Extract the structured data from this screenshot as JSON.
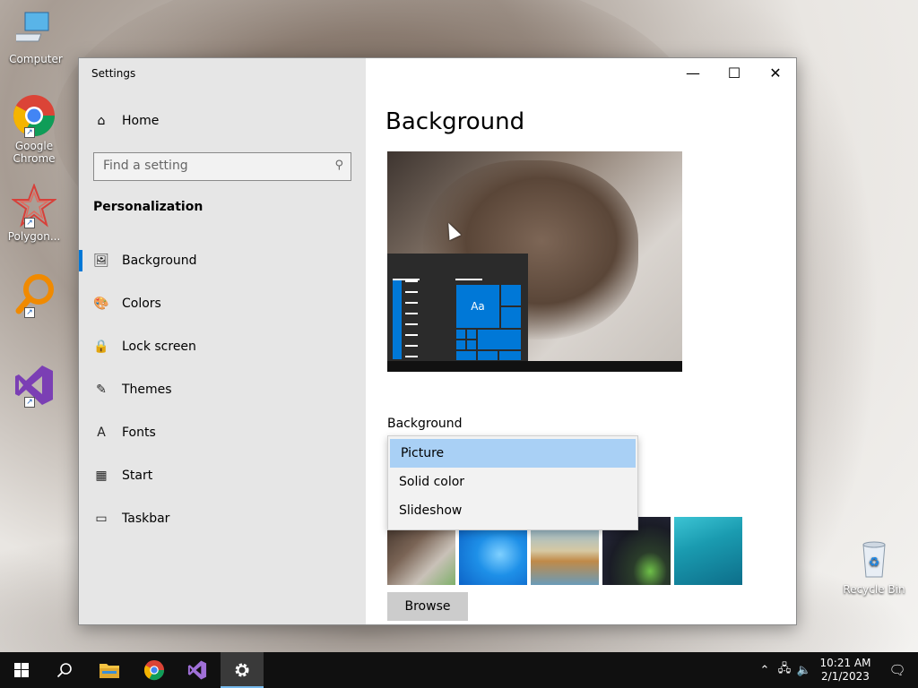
{
  "desktop": {
    "icons": [
      {
        "label": "Computer",
        "icon": "computer-icon"
      },
      {
        "label": "Google Chrome",
        "icon": "chrome-icon"
      },
      {
        "label": "Polygon...",
        "icon": "polygon-icon"
      },
      {
        "label": "",
        "icon": "magnifier-app-icon"
      },
      {
        "label": "",
        "icon": "visual-studio-icon"
      }
    ],
    "recycle_bin": "Recycle Bin"
  },
  "window": {
    "title": "Settings",
    "controls": {
      "minimize": "—",
      "maximize": "☐",
      "close": "✕"
    }
  },
  "sidebar": {
    "home_label": "Home",
    "search_placeholder": "Find a setting",
    "section_title": "Personalization",
    "items": [
      {
        "label": "Background",
        "icon": "picture-icon",
        "glyph": "🖼",
        "active": true
      },
      {
        "label": "Colors",
        "icon": "palette-icon",
        "glyph": "🎨",
        "active": false
      },
      {
        "label": "Lock screen",
        "icon": "lock-screen-icon",
        "glyph": "🔒",
        "active": false
      },
      {
        "label": "Themes",
        "icon": "themes-icon",
        "glyph": "✎",
        "active": false
      },
      {
        "label": "Fonts",
        "icon": "fonts-icon",
        "glyph": "A",
        "active": false
      },
      {
        "label": "Start",
        "icon": "start-icon",
        "glyph": "▦",
        "active": false
      },
      {
        "label": "Taskbar",
        "icon": "taskbar-icon",
        "glyph": "▭",
        "active": false
      }
    ]
  },
  "main": {
    "page_title": "Background",
    "preview_tile_text": "Aa",
    "background_label": "Background",
    "dropdown_options": [
      {
        "label": "Picture",
        "selected": true
      },
      {
        "label": "Solid color",
        "selected": false
      },
      {
        "label": "Slideshow",
        "selected": false
      }
    ],
    "browse_label": "Browse"
  },
  "taskbar": {
    "time": "10:21 AM",
    "date": "2/1/2023",
    "accent": "#76b9ed"
  },
  "colors": {
    "accent": "#0078d7",
    "sidebar_bg": "#e6e6e6",
    "selected_option": "#a9d0f5"
  }
}
